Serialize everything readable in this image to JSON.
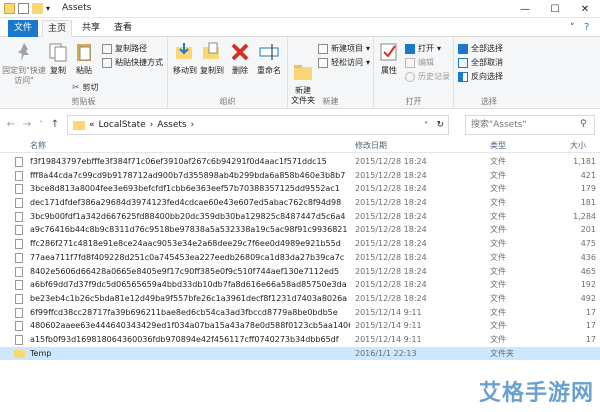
{
  "window": {
    "title": "Assets",
    "minimize": "—",
    "maximize": "☐",
    "close": "✕"
  },
  "tabs": {
    "file": "文件",
    "home": "主页",
    "share": "共享",
    "view": "查看"
  },
  "ribbon": {
    "clipboard": {
      "pin": "固定到\"快速访问\"",
      "copy": "复制",
      "paste": "粘贴",
      "copy_path": "复制路径",
      "paste_shortcut": "粘贴快捷方式",
      "cut": "剪切",
      "label": "剪贴板"
    },
    "organize": {
      "move_to": "移动到",
      "copy_to": "复制到",
      "delete": "删除",
      "rename": "重命名",
      "label": "组织"
    },
    "new": {
      "new_folder": "新建\n文件夹",
      "new_item": "新建项目",
      "easy_access": "轻松访问",
      "label": "新建"
    },
    "open": {
      "properties": "属性",
      "open": "打开",
      "edit": "编辑",
      "history": "历史记录",
      "label": "打开"
    },
    "select": {
      "select_all": "全部选择",
      "select_none": "全部取消",
      "invert": "反向选择",
      "label": "选择"
    }
  },
  "address": {
    "path": [
      "LocalState",
      "Assets"
    ],
    "sep": "›",
    "prefix": "«",
    "search_placeholder": "搜索\"Assets\""
  },
  "columns": {
    "name": "名称",
    "date": "修改日期",
    "type": "类型",
    "size": "大小"
  },
  "files": [
    {
      "name": "f3f19843797ebfffe3f384f71c06ef3910af267c6b94291f0d4aac1f571ddc15",
      "date": "2015/12/28 18:24",
      "type": "文件",
      "size": "1,181",
      "kind": "file"
    },
    {
      "name": "fff8a44cda7c99cd9b9178712ad900b7d355898ab4b299bda6a858b460e3b8b7",
      "date": "2015/12/28 18:24",
      "type": "文件",
      "size": "421",
      "kind": "file"
    },
    {
      "name": "3bce8d813a8004fee3e693befcfdf1cbb6e363eef57b70388357125dd9552ac1",
      "date": "2015/12/28 18:24",
      "type": "文件",
      "size": "179",
      "kind": "file"
    },
    {
      "name": "dec171dfdef386a29684d3974123fed4cdcae60e43e607ed5abac762c8f94d98",
      "date": "2015/12/28 18:24",
      "type": "文件",
      "size": "181",
      "kind": "file"
    },
    {
      "name": "3bc9b00fdf1a342d667625fd88400bb20dc359db30ba129825c8487447d5c6a4",
      "date": "2015/12/28 18:24",
      "type": "文件",
      "size": "1,284",
      "kind": "file"
    },
    {
      "name": "a9c76416b44c8b9c8311d76c9518be97838a5a532338a19c5ac98f91c9936821",
      "date": "2015/12/28 18:24",
      "type": "文件",
      "size": "201",
      "kind": "file"
    },
    {
      "name": "ffc286f271c4818e91e8ce24aac9053e34e2a68dee29c7f6ee0d4989e921b55d",
      "date": "2015/12/28 18:24",
      "type": "文件",
      "size": "475",
      "kind": "file"
    },
    {
      "name": "77aea711f7fd8f409228d251c0a745453ea227eedb26809ca1d83da27b39ca7c",
      "date": "2015/12/28 18:24",
      "type": "文件",
      "size": "436",
      "kind": "file"
    },
    {
      "name": "8402e5606d66428a0665e8405e9f17c90ff385e0f9c510f744aef130e7112ed5",
      "date": "2015/12/28 18:24",
      "type": "文件",
      "size": "465",
      "kind": "file"
    },
    {
      "name": "a6bf69dd7d37f9dc5d06565659a4bbd33db10db7fa8d616e66a58ad85750e3da",
      "date": "2015/12/28 18:24",
      "type": "文件",
      "size": "192",
      "kind": "file"
    },
    {
      "name": "be23eb4c1b26c5bda81e12d49ba9f557bfe26c1a3961decf8f1231d7403a8026a",
      "date": "2015/12/28 18:24",
      "type": "文件",
      "size": "492",
      "kind": "file"
    },
    {
      "name": "6f99ffcd38cc28717fa39b696211bae8ed6cb54ca3ad3fbccd8779a8be0bdb5e",
      "date": "2015/12/14 9:11",
      "type": "文件",
      "size": "17",
      "kind": "file"
    },
    {
      "name": "480602aaee63e444640343429ed1f034a07ba15a43a78e0d588f0123cb5aa1406",
      "date": "2015/12/14 9:11",
      "type": "文件",
      "size": "17",
      "kind": "file"
    },
    {
      "name": "a15fb0f93d169818064360036fdb970894e42f456117cff0740273b34dbb65df",
      "date": "2015/12/14 9:11",
      "type": "文件",
      "size": "17",
      "kind": "file"
    },
    {
      "name": "Temp",
      "date": "2016/1/1 22:13",
      "type": "文件夹",
      "size": "",
      "kind": "folder",
      "selected": true
    }
  ],
  "watermark": "艾格手游网"
}
